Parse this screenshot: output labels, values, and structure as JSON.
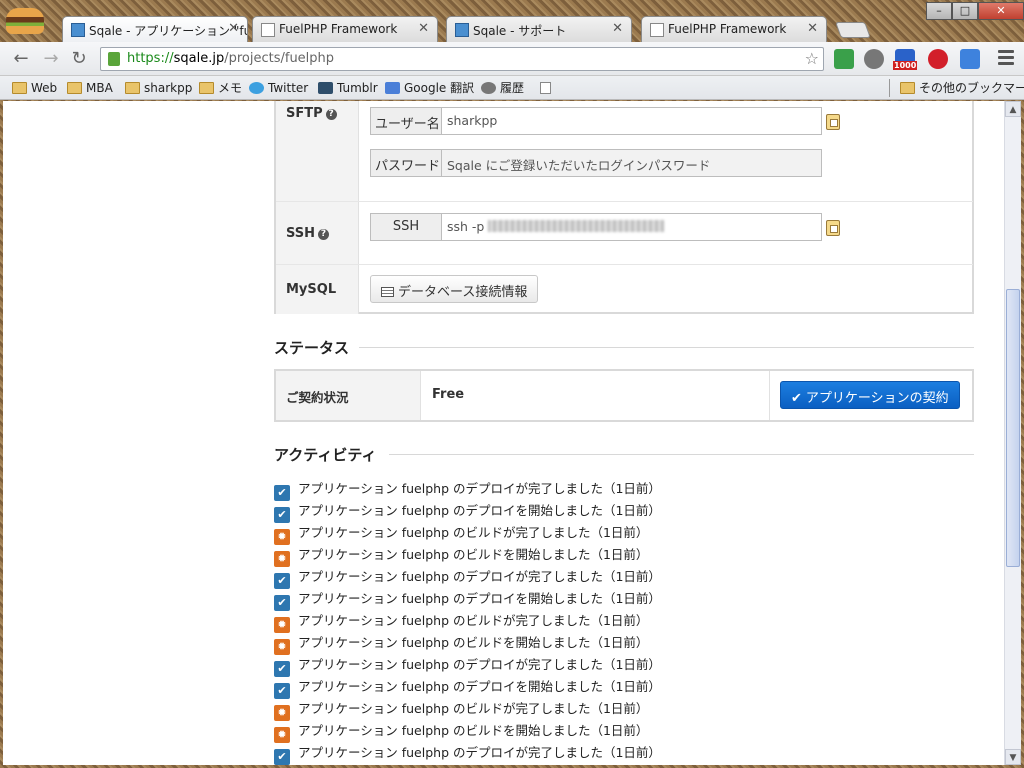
{
  "browser": {
    "tabs": [
      {
        "title": "Sqale - アプリケーション \"fue",
        "favicon": "sqale-favicon",
        "active": true
      },
      {
        "title": "FuelPHP Framework",
        "favicon": "page-favicon",
        "active": false
      },
      {
        "title": "Sqale - サポート",
        "favicon": "sqale-favicon",
        "active": false
      },
      {
        "title": "FuelPHP Framework",
        "favicon": "page-favicon",
        "active": false
      }
    ],
    "url_scheme": "https://",
    "url_host": "sqale.jp",
    "url_path": "/projects/fuelphp",
    "ext_badge": "1000",
    "bookmarks": [
      {
        "label": "Web",
        "icon": "folder-icon"
      },
      {
        "label": "MBA",
        "icon": "folder-icon"
      },
      {
        "label": "sharkpp",
        "icon": "folder-icon"
      },
      {
        "label": "メモ",
        "icon": "folder-icon"
      },
      {
        "label": "Twitter",
        "icon": "twitter-icon"
      },
      {
        "label": "Tumblr",
        "icon": "tumblr-icon"
      },
      {
        "label": "Google 翻訳",
        "icon": "google-translate-icon"
      },
      {
        "label": "履歴",
        "icon": "history-icon"
      },
      {
        "label": "",
        "icon": "page-icon"
      }
    ],
    "other_bookmarks": "その他のブックマーク"
  },
  "connection": {
    "sftp_label": "SFTP",
    "username_addon": "ユーザー名",
    "username_value": "sharkpp",
    "password_addon": "パスワード",
    "password_value": "Sqale にご登録いただいたログインパスワード",
    "ssh_label": "SSH",
    "ssh_addon": "SSH",
    "ssh_value_prefix": "ssh -p",
    "mysql_label": "MySQL",
    "db_button": "データベース接続情報"
  },
  "status": {
    "title": "ステータス",
    "contract_label": "ご契約状況",
    "contract_value": "Free",
    "contract_button": "アプリケーションの契約"
  },
  "activity": {
    "title": "アクティビティ",
    "items": [
      {
        "type": "deploy",
        "text": "アプリケーション fuelphp のデプロイが完了しました（1日前）"
      },
      {
        "type": "deploy",
        "text": "アプリケーション fuelphp のデプロイを開始しました（1日前）"
      },
      {
        "type": "build",
        "text": "アプリケーション fuelphp のビルドが完了しました（1日前）"
      },
      {
        "type": "build",
        "text": "アプリケーション fuelphp のビルドを開始しました（1日前）"
      },
      {
        "type": "deploy",
        "text": "アプリケーション fuelphp のデプロイが完了しました（1日前）"
      },
      {
        "type": "deploy",
        "text": "アプリケーション fuelphp のデプロイを開始しました（1日前）"
      },
      {
        "type": "build",
        "text": "アプリケーション fuelphp のビルドが完了しました（1日前）"
      },
      {
        "type": "build",
        "text": "アプリケーション fuelphp のビルドを開始しました（1日前）"
      },
      {
        "type": "deploy",
        "text": "アプリケーション fuelphp のデプロイが完了しました（1日前）"
      },
      {
        "type": "deploy",
        "text": "アプリケーション fuelphp のデプロイを開始しました（1日前）"
      },
      {
        "type": "build",
        "text": "アプリケーション fuelphp のビルドが完了しました（1日前）"
      },
      {
        "type": "build",
        "text": "アプリケーション fuelphp のビルドを開始しました（1日前）"
      },
      {
        "type": "deploy",
        "text": "アプリケーション fuelphp のデプロイが完了しました（1日前）"
      }
    ]
  },
  "colors": {
    "deploy_icon": "#2e77b0",
    "build_icon": "#e07020",
    "primary_button": "#0b5fc2",
    "url_scheme": "#1a8a1a"
  }
}
